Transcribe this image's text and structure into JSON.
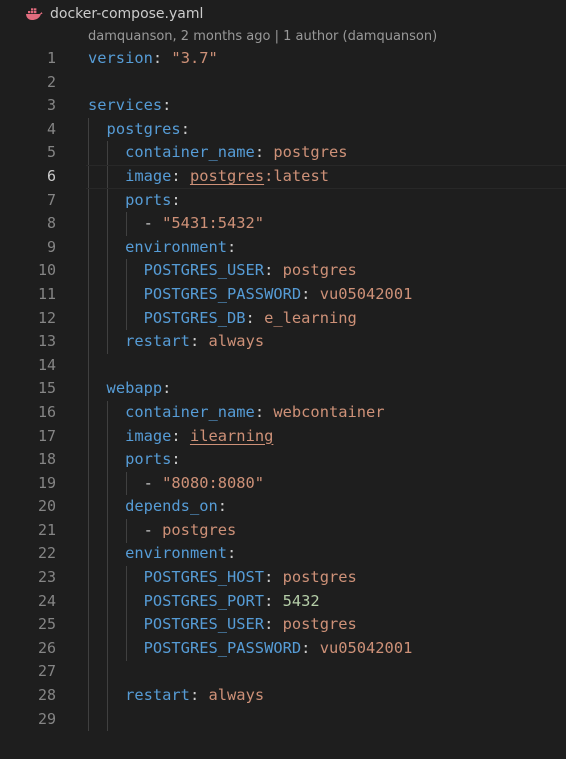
{
  "breadcrumb": {
    "filename": "docker-compose.yaml",
    "icon": "docker-whale-icon",
    "icon_color": "#e26c7e"
  },
  "codelens": {
    "text": "damquanson, 2 months ago | 1 author (damquanson)"
  },
  "editor": {
    "current_line": 6,
    "colors": {
      "background": "#1e1e1e",
      "key": "#569cd6",
      "string": "#ce9178",
      "number": "#b5cea8",
      "punctuation": "#cccccc",
      "line_number": "#858585"
    },
    "lines": [
      {
        "n": "1",
        "t": [
          [
            "k",
            "version"
          ],
          [
            "p",
            ": "
          ],
          [
            "s",
            "\"3.7\""
          ]
        ]
      },
      {
        "n": "2",
        "t": []
      },
      {
        "n": "3",
        "t": [
          [
            "k",
            "services"
          ],
          [
            "p",
            ":"
          ]
        ]
      },
      {
        "n": "4",
        "t": [
          [
            "p",
            "  "
          ],
          [
            "k",
            "postgres"
          ],
          [
            "p",
            ":"
          ]
        ]
      },
      {
        "n": "5",
        "t": [
          [
            "p",
            "    "
          ],
          [
            "k",
            "container_name"
          ],
          [
            "p",
            ": "
          ],
          [
            "s",
            "postgres"
          ]
        ]
      },
      {
        "n": "6",
        "t": [
          [
            "p",
            "    "
          ],
          [
            "k",
            "image"
          ],
          [
            "p",
            ": "
          ],
          [
            "su",
            "postgres"
          ],
          [
            "s",
            ":latest"
          ]
        ]
      },
      {
        "n": "7",
        "t": [
          [
            "p",
            "    "
          ],
          [
            "k",
            "ports"
          ],
          [
            "p",
            ":"
          ]
        ]
      },
      {
        "n": "8",
        "t": [
          [
            "p",
            "      - "
          ],
          [
            "s",
            "\"5431:5432\""
          ]
        ]
      },
      {
        "n": "9",
        "t": [
          [
            "p",
            "    "
          ],
          [
            "k",
            "environment"
          ],
          [
            "p",
            ":"
          ]
        ]
      },
      {
        "n": "10",
        "t": [
          [
            "p",
            "      "
          ],
          [
            "k",
            "POSTGRES_USER"
          ],
          [
            "p",
            ": "
          ],
          [
            "s",
            "postgres"
          ]
        ]
      },
      {
        "n": "11",
        "t": [
          [
            "p",
            "      "
          ],
          [
            "k",
            "POSTGRES_PASSWORD"
          ],
          [
            "p",
            ": "
          ],
          [
            "s",
            "vu05042001"
          ]
        ]
      },
      {
        "n": "12",
        "t": [
          [
            "p",
            "      "
          ],
          [
            "k",
            "POSTGRES_DB"
          ],
          [
            "p",
            ": "
          ],
          [
            "s",
            "e_learning"
          ]
        ]
      },
      {
        "n": "13",
        "t": [
          [
            "p",
            "    "
          ],
          [
            "k",
            "restart"
          ],
          [
            "p",
            ": "
          ],
          [
            "s",
            "always"
          ]
        ]
      },
      {
        "n": "14",
        "t": []
      },
      {
        "n": "15",
        "t": [
          [
            "p",
            "  "
          ],
          [
            "k",
            "webapp"
          ],
          [
            "p",
            ":"
          ]
        ]
      },
      {
        "n": "16",
        "t": [
          [
            "p",
            "    "
          ],
          [
            "k",
            "container_name"
          ],
          [
            "p",
            ": "
          ],
          [
            "s",
            "webcontainer"
          ]
        ]
      },
      {
        "n": "17",
        "t": [
          [
            "p",
            "    "
          ],
          [
            "k",
            "image"
          ],
          [
            "p",
            ": "
          ],
          [
            "su",
            "ilearning"
          ]
        ]
      },
      {
        "n": "18",
        "t": [
          [
            "p",
            "    "
          ],
          [
            "k",
            "ports"
          ],
          [
            "p",
            ":"
          ]
        ]
      },
      {
        "n": "19",
        "t": [
          [
            "p",
            "      - "
          ],
          [
            "s",
            "\"8080:8080\""
          ]
        ]
      },
      {
        "n": "20",
        "t": [
          [
            "p",
            "    "
          ],
          [
            "k",
            "depends_on"
          ],
          [
            "p",
            ":"
          ]
        ]
      },
      {
        "n": "21",
        "t": [
          [
            "p",
            "      - "
          ],
          [
            "s",
            "postgres"
          ]
        ]
      },
      {
        "n": "22",
        "t": [
          [
            "p",
            "    "
          ],
          [
            "k",
            "environment"
          ],
          [
            "p",
            ":"
          ]
        ]
      },
      {
        "n": "23",
        "t": [
          [
            "p",
            "      "
          ],
          [
            "k",
            "POSTGRES_HOST"
          ],
          [
            "p",
            ": "
          ],
          [
            "s",
            "postgres"
          ]
        ]
      },
      {
        "n": "24",
        "t": [
          [
            "p",
            "      "
          ],
          [
            "k",
            "POSTGRES_PORT"
          ],
          [
            "p",
            ": "
          ],
          [
            "n",
            "5432"
          ]
        ]
      },
      {
        "n": "25",
        "t": [
          [
            "p",
            "      "
          ],
          [
            "k",
            "POSTGRES_USER"
          ],
          [
            "p",
            ": "
          ],
          [
            "s",
            "postgres"
          ]
        ]
      },
      {
        "n": "26",
        "t": [
          [
            "p",
            "      "
          ],
          [
            "k",
            "POSTGRES_PASSWORD"
          ],
          [
            "p",
            ": "
          ],
          [
            "s",
            "vu05042001"
          ]
        ]
      },
      {
        "n": "27",
        "t": []
      },
      {
        "n": "28",
        "t": [
          [
            "p",
            "    "
          ],
          [
            "k",
            "restart"
          ],
          [
            "p",
            ": "
          ],
          [
            "s",
            "always"
          ]
        ]
      },
      {
        "n": "29",
        "t": []
      }
    ]
  }
}
